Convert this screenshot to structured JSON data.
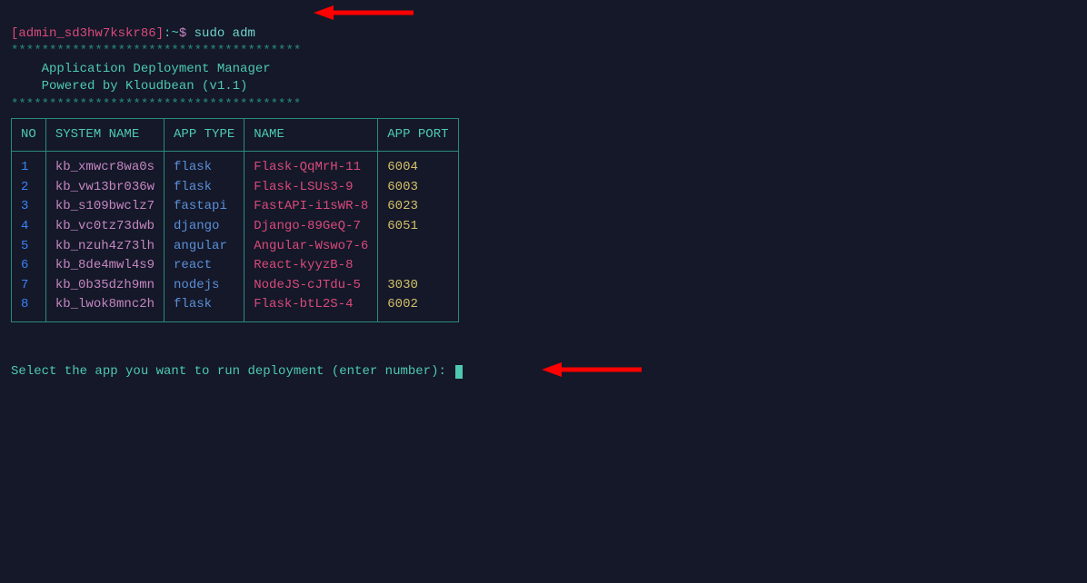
{
  "prompt": {
    "user": "[admin_sd3hw7kskr86]",
    "separator": ":~",
    "dollar": "$ ",
    "command": "sudo adm"
  },
  "banner": {
    "stars": "**************************************",
    "line1": "    Application Deployment Manager",
    "line2": "    Powered by Kloudbean (v1.1)"
  },
  "table": {
    "headers": {
      "no": "NO",
      "system": "SYSTEM NAME",
      "apptype": "APP TYPE",
      "name": "NAME",
      "port": "APP PORT"
    },
    "rows": [
      {
        "no": "1",
        "system": "kb_xmwcr8wa0s",
        "apptype": "flask",
        "name": "Flask-QqMrH-11",
        "port": "6004"
      },
      {
        "no": "2",
        "system": "kb_vw13br036w",
        "apptype": "flask",
        "name": "Flask-LSUs3-9",
        "port": "6003"
      },
      {
        "no": "3",
        "system": "kb_s109bwclz7",
        "apptype": "fastapi",
        "name": "FastAPI-i1sWR-8",
        "port": "6023"
      },
      {
        "no": "4",
        "system": "kb_vc0tz73dwb",
        "apptype": "django",
        "name": "Django-89GeQ-7",
        "port": "6051"
      },
      {
        "no": "5",
        "system": "kb_nzuh4z73lh",
        "apptype": "angular",
        "name": "Angular-Wswo7-6",
        "port": ""
      },
      {
        "no": "6",
        "system": "kb_8de4mwl4s9",
        "apptype": "react",
        "name": "React-kyyzB-8",
        "port": ""
      },
      {
        "no": "7",
        "system": "kb_0b35dzh9mn",
        "apptype": "nodejs",
        "name": "NodeJS-cJTdu-5",
        "port": "3030"
      },
      {
        "no": "8",
        "system": "kb_lwok8mnc2h",
        "apptype": "flask",
        "name": "Flask-btL2S-4",
        "port": "6002"
      }
    ]
  },
  "select_prompt": "Select the app you want to run deployment (enter number): "
}
